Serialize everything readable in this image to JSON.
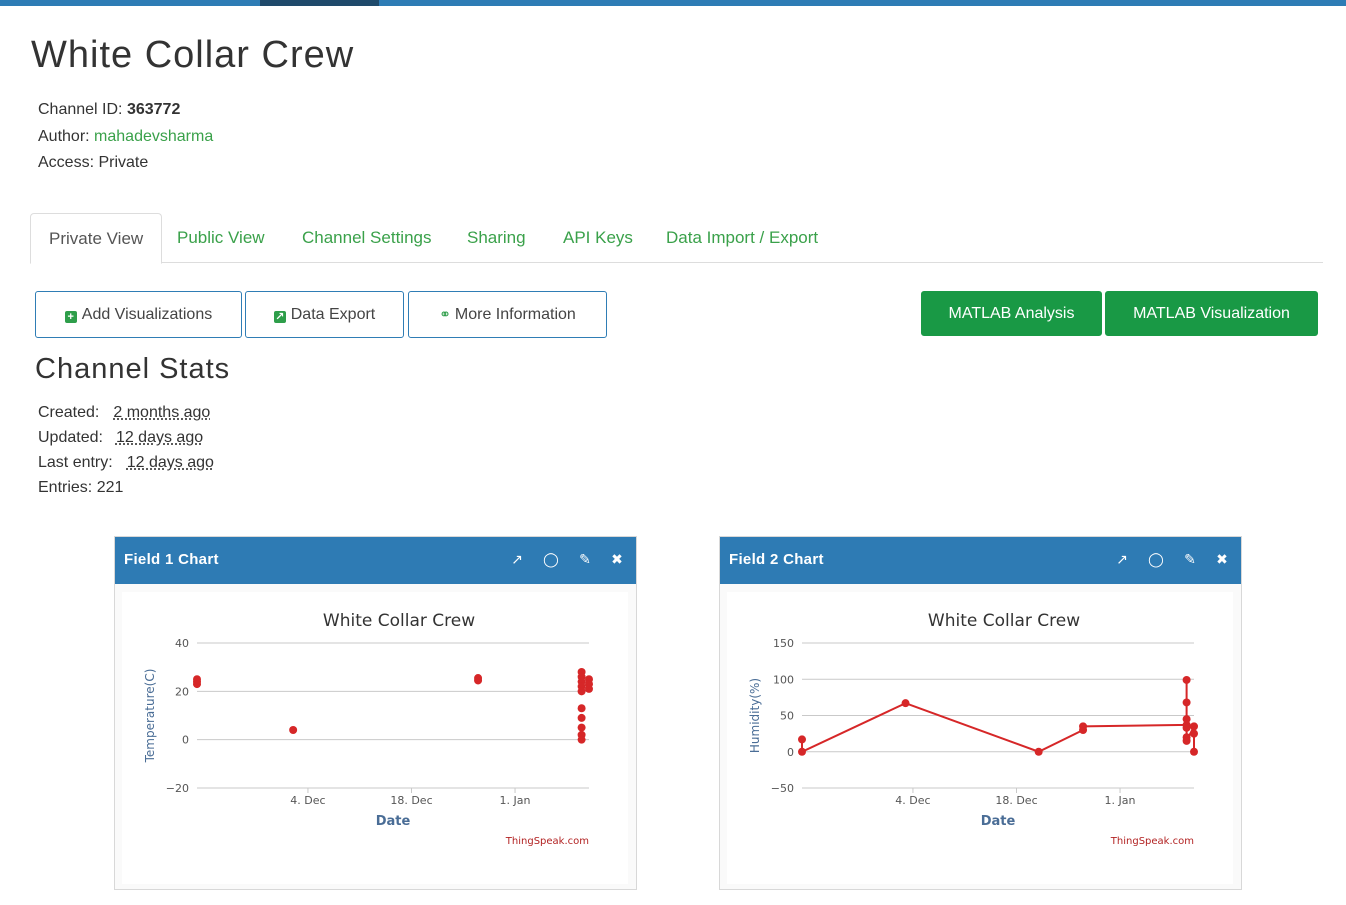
{
  "channel": {
    "title": "White Collar Crew",
    "id_label": "Channel ID:",
    "id_value": "363772",
    "author_label": "Author:",
    "author_value": "mahadevsharma",
    "access_label": "Access:",
    "access_value": "Private"
  },
  "tabs": [
    {
      "label": "Private View",
      "active": true
    },
    {
      "label": "Public View",
      "active": false
    },
    {
      "label": "Channel Settings",
      "active": false
    },
    {
      "label": "Sharing",
      "active": false
    },
    {
      "label": "API Keys",
      "active": false
    },
    {
      "label": "Data Import / Export",
      "active": false
    }
  ],
  "toolbar": {
    "add_viz": "Add Visualizations",
    "data_export": "Data Export",
    "more_info": "More Information",
    "matlab_analysis": "MATLAB Analysis",
    "matlab_viz": "MATLAB Visualization"
  },
  "stats": {
    "heading": "Channel Stats",
    "created_label": "Created:",
    "created_value": "2 months ago",
    "updated_label": "Updated:",
    "updated_value": "12 days ago",
    "last_entry_label": "Last entry:",
    "last_entry_value": "12 days ago",
    "entries_label": "Entries:",
    "entries_value": "221"
  },
  "colors": {
    "brand_blue": "#2e7bb4",
    "green_button": "#199945",
    "link_green": "#3aa14a",
    "series_red": "#d62728"
  },
  "charts": [
    {
      "panel_title": "Field 1 Chart",
      "icons": [
        "external-link-icon",
        "comment-icon",
        "pencil-icon",
        "close-icon"
      ],
      "chart_data": {
        "type": "scatter",
        "title": "White Collar Crew",
        "xlabel": "Date",
        "ylabel": "Temperature(C)",
        "credit": "ThingSpeak.com",
        "ylim": [
          -20,
          40
        ],
        "yticks": [
          40,
          20,
          0,
          -20
        ],
        "xlim": [
          "2017-11-19",
          "2018-01-11"
        ],
        "xticks": [
          {
            "label": "4. Dec",
            "date": "2017-12-04"
          },
          {
            "label": "18. Dec",
            "date": "2017-12-18"
          },
          {
            "label": "1. Jan",
            "date": "2018-01-01"
          }
        ],
        "series": [
          {
            "color": "#d62728",
            "points": [
              [
                "2017-11-19",
                23
              ],
              [
                "2017-11-19",
                24
              ],
              [
                "2017-11-19",
                25
              ],
              [
                "2017-12-02",
                4
              ],
              [
                "2017-12-27",
                24.5
              ],
              [
                "2017-12-27",
                25.5
              ],
              [
                "2018-01-10",
                28
              ],
              [
                "2018-01-10",
                26
              ],
              [
                "2018-01-10",
                24
              ],
              [
                "2018-01-10",
                22
              ],
              [
                "2018-01-10",
                20
              ],
              [
                "2018-01-10",
                13
              ],
              [
                "2018-01-10",
                9
              ],
              [
                "2018-01-10",
                5
              ],
              [
                "2018-01-10",
                2
              ],
              [
                "2018-01-10",
                0
              ],
              [
                "2018-01-11",
                25
              ],
              [
                "2018-01-11",
                23
              ],
              [
                "2018-01-11",
                21
              ]
            ]
          }
        ],
        "grid": true
      }
    },
    {
      "panel_title": "Field 2 Chart",
      "icons": [
        "external-link-icon",
        "comment-icon",
        "pencil-icon",
        "close-icon"
      ],
      "chart_data": {
        "type": "line",
        "title": "White Collar Crew",
        "xlabel": "Date",
        "ylabel": "Humidity(%)",
        "credit": "ThingSpeak.com",
        "ylim": [
          -50,
          150
        ],
        "yticks": [
          150,
          100,
          50,
          0,
          -50
        ],
        "xlim": [
          "2017-11-19",
          "2018-01-11"
        ],
        "xticks": [
          {
            "label": "4. Dec",
            "date": "2017-12-04"
          },
          {
            "label": "18. Dec",
            "date": "2017-12-18"
          },
          {
            "label": "1. Jan",
            "date": "2018-01-01"
          }
        ],
        "series": [
          {
            "color": "#d62728",
            "points": [
              [
                "2017-11-19",
                17
              ],
              [
                "2017-11-19",
                0
              ],
              [
                "2017-12-03",
                67
              ],
              [
                "2017-12-21",
                0
              ],
              [
                "2017-12-27",
                30
              ],
              [
                "2017-12-27",
                35
              ],
              [
                "2018-01-10",
                37
              ],
              [
                "2018-01-10",
                99
              ],
              [
                "2018-01-10",
                68
              ],
              [
                "2018-01-10",
                45
              ],
              [
                "2018-01-10",
                33
              ],
              [
                "2018-01-10",
                20
              ],
              [
                "2018-01-10",
                15
              ],
              [
                "2018-01-11",
                35
              ],
              [
                "2018-01-11",
                25
              ],
              [
                "2018-01-11",
                0
              ]
            ]
          }
        ],
        "grid": true
      }
    }
  ]
}
